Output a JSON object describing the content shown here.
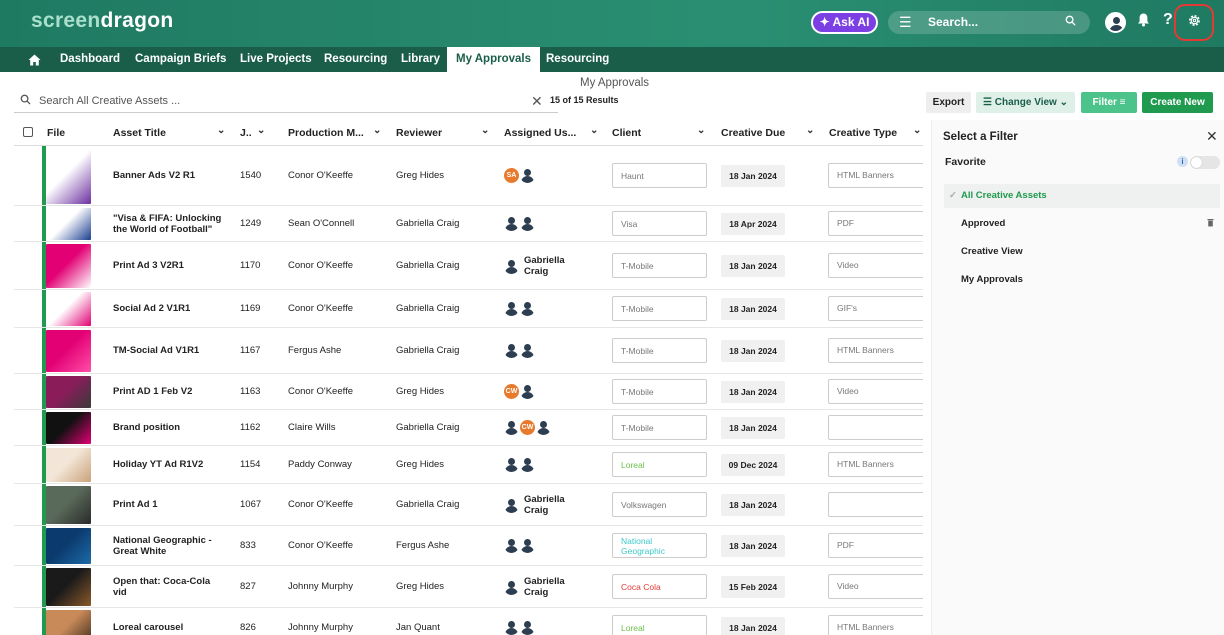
{
  "app": {
    "logo_screen": "screen",
    "logo_dragon": "dragon",
    "ask_ai": "✦ Ask AI",
    "search_placeholder": "Search...",
    "help_glyph": "?"
  },
  "nav": {
    "items": [
      "Dashboard",
      "Campaign Briefs",
      "Live Projects",
      "Resourcing",
      "Library",
      "My Approvals",
      "Resourcing"
    ],
    "active": "My Approvals"
  },
  "page": {
    "subtitle": "My Approvals",
    "search_prefix": "Search",
    "search_placeholder": "All Creative Assets ...",
    "results": "15 of 15 Results"
  },
  "toolbar": {
    "export": "Export",
    "change_view": "Change View",
    "filter": "Filter",
    "create_new": "Create New"
  },
  "columns": [
    "File",
    "Asset Title",
    "J..",
    "Production M...",
    "Reviewer",
    "Assigned Us...",
    "Client",
    "Creative Due",
    "Creative Type"
  ],
  "rows": [
    {
      "title": "Banner Ads V2 R1",
      "job": "1540",
      "pm": "Conor O'Keeffe",
      "reviewer": "Greg Hides",
      "assigned": [
        "SA",
        "person"
      ],
      "assigned_name": "",
      "client": "Haunt",
      "client_color": "#777",
      "due": "18 Jan 2024",
      "type": "HTML Banners",
      "thumb": [
        "#ffffff",
        "#6b2fa0"
      ]
    },
    {
      "title": "\"Visa & FIFA: Unlocking the World of Football\"",
      "job": "1249",
      "pm": "Sean O'Connell",
      "reviewer": "Gabriella Craig",
      "assigned": [
        "person",
        "person"
      ],
      "assigned_name": "",
      "client": "Visa",
      "client_color": "#777",
      "due": "18 Apr 2024",
      "type": "PDF",
      "thumb": [
        "#ffffff",
        "#1a3d8f"
      ]
    },
    {
      "title": "Print Ad 3 V2R1",
      "job": "1170",
      "pm": "Conor O'Keeffe",
      "reviewer": "Gabriella Craig",
      "assigned": [
        "person"
      ],
      "assigned_name": "Gabriella Craig",
      "client": "T-Mobile",
      "client_color": "#777",
      "due": "18 Jan 2024",
      "type": "Video",
      "thumb": [
        "#e20074",
        "#ffffff"
      ]
    },
    {
      "title": "Social Ad 2 V1R1",
      "job": "1169",
      "pm": "Conor O'Keeffe",
      "reviewer": "Gabriella Craig",
      "assigned": [
        "person",
        "person"
      ],
      "assigned_name": "",
      "client": "T-Mobile",
      "client_color": "#777",
      "due": "18 Jan 2024",
      "type": "GIF's",
      "thumb": [
        "#ffffff",
        "#e20074"
      ]
    },
    {
      "title": "TM-Social Ad V1R1",
      "job": "1167",
      "pm": "Fergus Ashe",
      "reviewer": "Gabriella Craig",
      "assigned": [
        "person",
        "person"
      ],
      "assigned_name": "",
      "client": "T-Mobile",
      "client_color": "#777",
      "due": "18 Jan 2024",
      "type": "HTML Banners",
      "thumb": [
        "#e20074",
        "#ff4fa8"
      ]
    },
    {
      "title": "Print AD 1 Feb V2",
      "job": "1163",
      "pm": "Conor O'Keeffe",
      "reviewer": "Greg Hides",
      "assigned": [
        "CW",
        "person"
      ],
      "assigned_name": "",
      "client": "T-Mobile",
      "client_color": "#777",
      "due": "18 Jan 2024",
      "type": "Video",
      "thumb": [
        "#8a1c5a",
        "#3a3a3a"
      ]
    },
    {
      "title": "Brand position",
      "job": "1162",
      "pm": "Claire Wills",
      "reviewer": "Gabriella Craig",
      "assigned": [
        "person",
        "CW",
        "person"
      ],
      "assigned_name": "",
      "client": "T-Mobile",
      "client_color": "#777",
      "due": "18 Jan 2024",
      "type": "",
      "thumb": [
        "#111111",
        "#e20074"
      ]
    },
    {
      "title": "Holiday YT Ad R1V2",
      "job": "1154",
      "pm": "Paddy Conway",
      "reviewer": "Greg Hides",
      "assigned": [
        "person",
        "person"
      ],
      "assigned_name": "",
      "client": "Loreal",
      "client_color": "#6cc04a",
      "due": "09 Dec 2024",
      "type": "HTML Banners",
      "thumb": [
        "#f3e6d8",
        "#c9a27a"
      ]
    },
    {
      "title": "Print Ad 1",
      "job": "1067",
      "pm": "Conor O'Keeffe",
      "reviewer": "Gabriella Craig",
      "assigned": [
        "person"
      ],
      "assigned_name": "Gabriella Craig",
      "client": "Volkswagen",
      "client_color": "#777",
      "due": "18 Jan 2024",
      "type": "",
      "thumb": [
        "#5a6a5a",
        "#2a2a2a"
      ]
    },
    {
      "title": "National Geographic - Great White",
      "job": "833",
      "pm": "Conor O'Keeffe",
      "reviewer": "Fergus Ashe",
      "assigned": [
        "person",
        "person"
      ],
      "assigned_name": "",
      "client": "National Geographic",
      "client_color": "#3cc8c8",
      "due": "18 Jan 2024",
      "type": "PDF",
      "thumb": [
        "#0b3b6e",
        "#1d6aa8"
      ]
    },
    {
      "title": "Open that: Coca-Cola vid",
      "job": "827",
      "pm": "Johnny Murphy",
      "reviewer": "Greg Hides",
      "assigned": [
        "person"
      ],
      "assigned_name": "Gabriella Craig",
      "client": "Coca Cola",
      "client_color": "#e53935",
      "due": "15 Feb 2024",
      "type": "Video",
      "thumb": [
        "#1a1a1a",
        "#8a5a2a"
      ]
    },
    {
      "title": "Loreal carousel",
      "job": "826",
      "pm": "Johnny Murphy",
      "reviewer": "Jan Quant",
      "assigned": [
        "person",
        "person"
      ],
      "assigned_name": "",
      "client": "Loreal",
      "client_color": "#6cc04a",
      "due": "18 Jan 2024",
      "type": "HTML Banners",
      "thumb": [
        "#c98a5a",
        "#3a2a1a"
      ]
    }
  ],
  "panel": {
    "title": "Select a Filter",
    "favorite": "Favorite",
    "info": "i",
    "items": [
      {
        "label": "All Creative Assets",
        "mark": "✓",
        "selected": true,
        "trash": false
      },
      {
        "label": "Approved",
        "mark": "",
        "selected": false,
        "trash": true
      },
      {
        "label": "Creative View",
        "mark": "",
        "selected": false,
        "trash": false
      },
      {
        "label": "My Approvals",
        "mark": "",
        "selected": false,
        "trash": false
      }
    ]
  }
}
